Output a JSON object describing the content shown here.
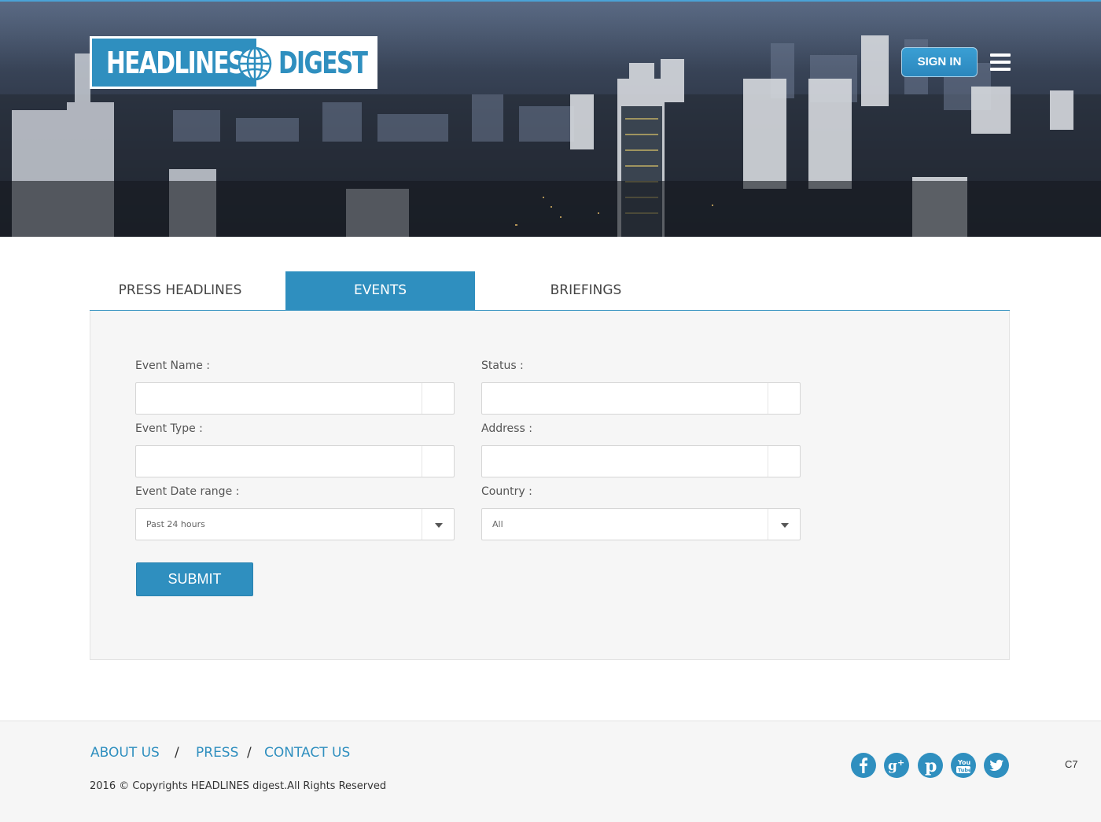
{
  "header": {
    "logo_word1": "HEADLINES",
    "logo_word2": "DIGEST",
    "signin_label": "SIGN IN",
    "menu_icon": "hamburger-menu-icon"
  },
  "tabs": [
    {
      "label": "PRESS HEADLINES",
      "active": false
    },
    {
      "label": "EVENTS",
      "active": true
    },
    {
      "label": "BRIEFINGS",
      "active": false
    }
  ],
  "form": {
    "event_name": {
      "label": "Event Name :",
      "value": ""
    },
    "status": {
      "label": "Status :",
      "value": ""
    },
    "event_type": {
      "label": "Event Type :",
      "value": ""
    },
    "address": {
      "label": "Address :",
      "value": ""
    },
    "date_range": {
      "label": "Event Date range :",
      "value": "Past 24 hours"
    },
    "country": {
      "label": "Country :",
      "value": "All"
    },
    "submit_label": "SUBMIT"
  },
  "footer": {
    "links": [
      "ABOUT US",
      "PRESS",
      "CONTACT US"
    ],
    "separator": "/",
    "copyright": "2016 © Copyrights HEADLINES digest.All Rights Reserved",
    "social": [
      "facebook-icon",
      "google-plus-icon",
      "pinterest-icon",
      "youtube-icon",
      "twitter-icon"
    ],
    "corner_code": "C7"
  },
  "colors": {
    "brand_blue": "#2f8fbf",
    "panel_bg": "#f6f6f6"
  }
}
